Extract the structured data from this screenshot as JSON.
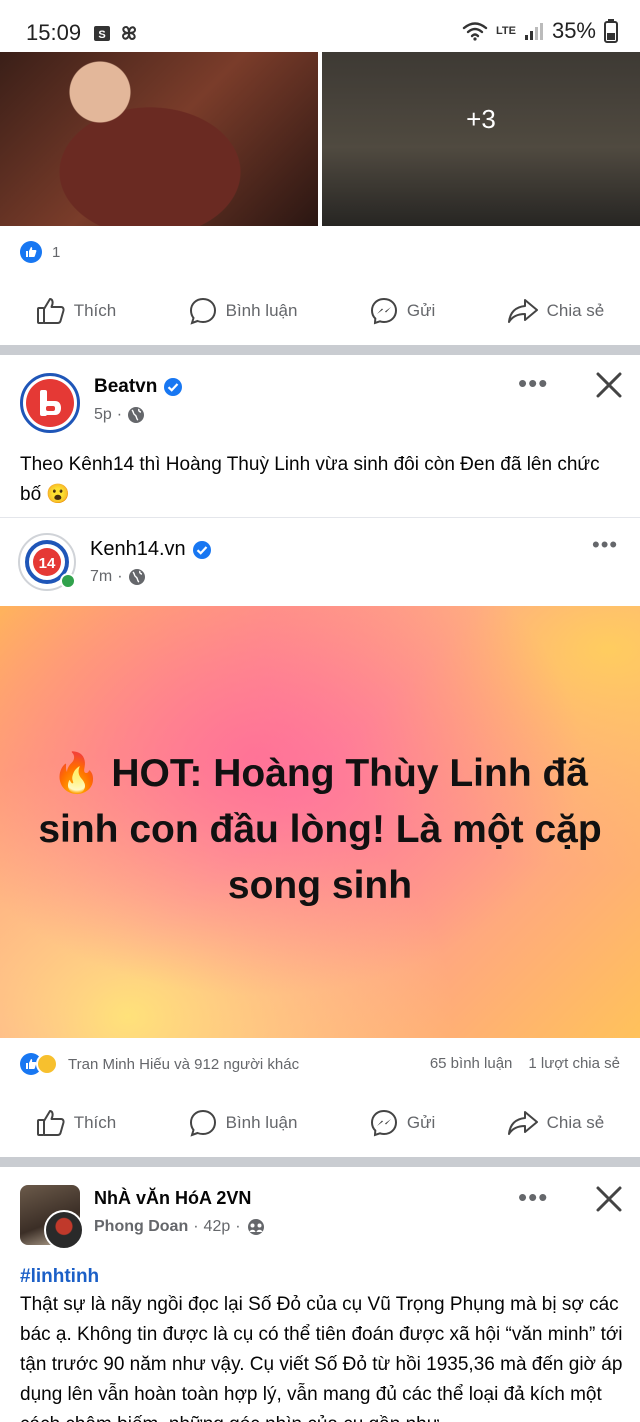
{
  "status_bar": {
    "time": "15:09",
    "network": "LTE",
    "battery": "35%"
  },
  "post1": {
    "more_photos": "+3",
    "reaction_count": "1"
  },
  "actions": {
    "like": "Thích",
    "comment": "Bình luận",
    "send": "Gửi",
    "share": "Chia sẻ"
  },
  "post2": {
    "author": "Beatvn",
    "time": "5p",
    "text": "Theo Kênh14 thì Hoàng Thuỳ Linh vừa sinh đôi còn Đen đã lên chức bố 😮",
    "shared": {
      "author": "Kenh14.vn",
      "time": "7m",
      "card_text": "🔥 HOT: Hoàng Thùy Linh đã sinh con đầu lòng! Là một cặp song sinh"
    },
    "reactions_text": "Tran Minh Hiếu và 912 người khác",
    "comments": "65 bình luận",
    "shares": "1 lượt chia sẻ"
  },
  "post3": {
    "group": "NhÀ vĂn HóA 2VN",
    "author": "Phong Doan",
    "time": "42p",
    "hashtag": "#linhtinh",
    "text": "Thật sự là nãy ngồi đọc lại Số Đỏ của cụ Vũ Trọng Phụng mà bị sợ các bác ạ. Không tin được là cụ có thể tiên đoán được xã hội “văn minh” tới tận trước 90 năm như vậy. Cụ viết Số Đỏ từ hồi 1935,36 mà đến giờ áp dụng lên vẫn hoàn toàn hợp lý, vẫn mang đủ các thể loại đả kích một cách châm biếm, những góc nhìn của cụ gần như"
  },
  "colors": {
    "facebook_blue": "#1877f2",
    "text": "#050505",
    "secondary": "#65676b"
  }
}
